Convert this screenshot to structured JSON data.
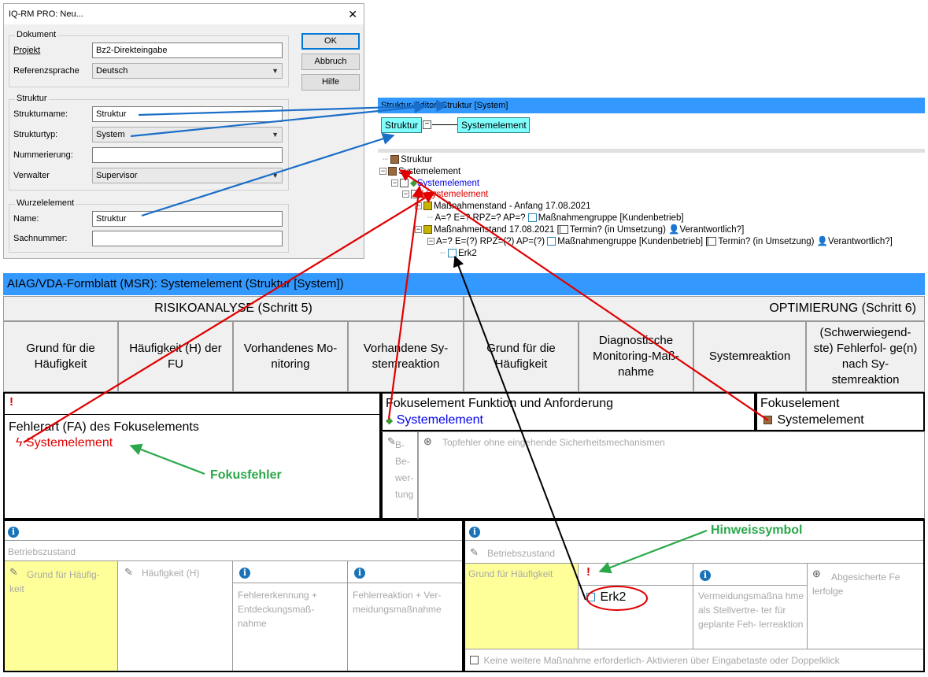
{
  "dialog": {
    "title": "IQ-RM PRO: Neu...",
    "close": "✕",
    "dokument": {
      "group": "Dokument",
      "projekt_label": "Projekt",
      "projekt_value": "Bz2-Direkteingabe",
      "sprache_label": "Referenzsprache",
      "sprache_value": "Deutsch"
    },
    "struktur": {
      "group": "Struktur",
      "name_label": "Strukturname:",
      "name_value": "Struktur",
      "typ_label": "Strukturtyp:",
      "typ_value": "System",
      "nummer_label": "Nummerierung:",
      "nummer_value": "",
      "verwalter_label": "Verwalter",
      "verwalter_value": "Supervisor"
    },
    "wurzel": {
      "group": "Wurzelelement",
      "name_label": "Name:",
      "name_value": "Struktur",
      "sach_label": "Sachnummer:",
      "sach_value": ""
    },
    "buttons": {
      "ok": "OK",
      "abbruch": "Abbruch",
      "hilfe": "Hilfe"
    }
  },
  "structure_editor": {
    "title": "Struktur-Editor: Struktur [System]",
    "root_box": "Struktur",
    "child_box": "Systemelement",
    "tree": [
      "Struktur",
      "Systemelement",
      "Systemelement",
      "Systemelement",
      "Maßnahmenstand - Anfang 17.08.2021",
      "A=? E=? RPZ=? AP=?",
      "Maßnahmengruppe [Kundenbetrieb]",
      "Maßnahmenstand 17.08.2021",
      "Termin? (in Umsetzung)",
      "Verantwortlich?]",
      "A=? E=(?) RPZ=(?) AP=(?)",
      "Maßnahmengruppe [Kundenbetrieb]",
      "Termin? (in Umsetzung)",
      "Verantwortlich?]",
      "Erk2"
    ]
  },
  "form": {
    "title": "AIAG/VDA-Formblatt (MSR): Systemelement (Struktur [System])",
    "risiko": "RISIKOANALYSE (Schritt 5)",
    "optimierung": "OPTIMIERUNG (Schritt 6)",
    "columns": [
      "Grund für die Häufigkeit",
      "Häufigkeit (H) der FU",
      "Vorhandenes Mo- nitoring",
      "Vorhandene Sy- stemreaktion",
      "Grund für die Häufigkeit",
      "Diagnostische Monitoring-Maß- nahme",
      "Systemreaktion",
      "(Schwerwiegend- ste) Fehlerfol- ge(n) nach Sy- stemreaktion"
    ],
    "fehlerart_label": "Fehlerart (FA) des Fokuselements",
    "fehlerart_value": "Systemelement",
    "funktion_label": "Fokuselement Funktion und Anforderung",
    "funktion_value": "Systemelement",
    "fokus_label": "Fokuselement",
    "fokus_value": "Systemelement",
    "bewertung": "B- Be- wer- tung",
    "topfehler": "Topfehler ohne eingehende Sicherheitsmechanismen",
    "betriebszustand_left": "Betriebszustand",
    "betriebszustand_right": "Betriebszustand",
    "grund_left": "Grund für Häufig- keit",
    "haeufigkeit": "Häufigkeit (H)",
    "fehlererkennung": "Fehlererkennung + Entdeckungsmaß- nahme",
    "fehlerreaktion": "Fehlerreaktion + Ver- meidungsmaßnahme",
    "grund_right": "Grund für Häufigkeit",
    "erk2": "Erk2",
    "vermeidung": "Vermeidungsmaßna hme als Stellvertre- ter für geplante Feh- lerreaktion",
    "abgesichert": "Abgesicherte Fe lerfolge",
    "keine": "Keine weitere Maßnahme erforderlich- Aktivieren über Eingabetaste oder Doppelklick"
  },
  "annotations": {
    "fokusfehler": "Fokusfehler",
    "hinweissymbol": "Hinweissymbol"
  },
  "colors": {
    "title_bar": "#3399ff",
    "annotation_green": "#2aa84a",
    "arrow_red": "#e00000",
    "arrow_blue": "#1a6ec8",
    "highlight_yellow": "#ffff99"
  }
}
